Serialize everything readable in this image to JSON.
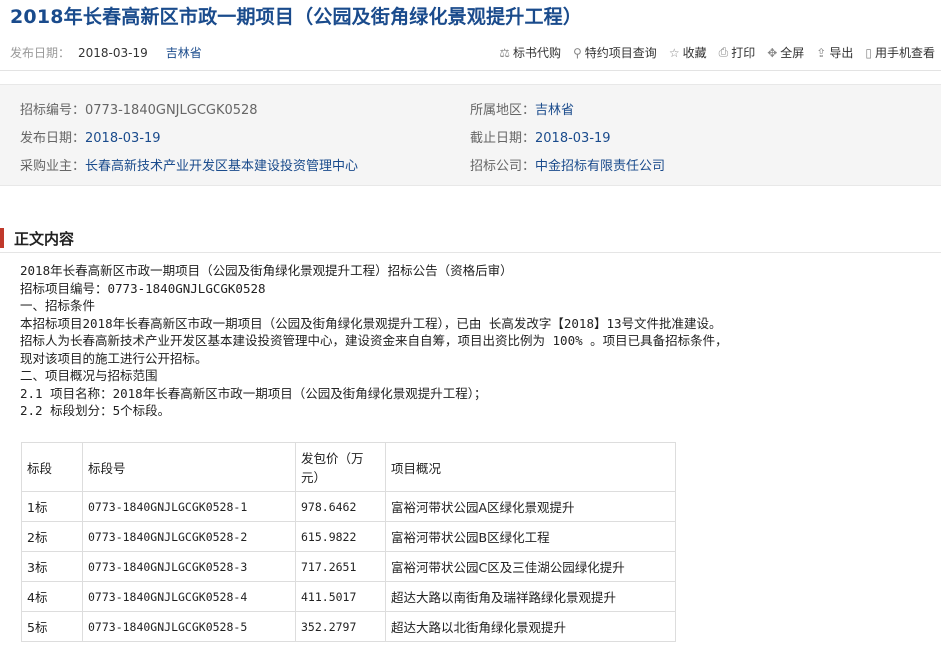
{
  "page_title": "2018年长春高新区市政一期项目（公园及街角绿化景观提升工程）",
  "meta": {
    "publish_label": "发布日期：",
    "publish_date": "2018-03-19",
    "province": "吉林省"
  },
  "toolbar": [
    {
      "label": "标书代购",
      "icon": "document-icon",
      "glyph": "⚖"
    },
    {
      "label": "特约项目查询",
      "icon": "search-icon",
      "glyph": "⚲"
    },
    {
      "label": "收藏",
      "icon": "star-icon",
      "glyph": "☆"
    },
    {
      "label": "打印",
      "icon": "print-icon",
      "glyph": "⎙"
    },
    {
      "label": "全屏",
      "icon": "fullscreen-icon",
      "glyph": "✥"
    },
    {
      "label": "导出",
      "icon": "export-icon",
      "glyph": "⇪"
    },
    {
      "label": "用手机查看",
      "icon": "phone-icon",
      "glyph": "▯"
    }
  ],
  "info": {
    "bid_no_label": "招标编号：",
    "bid_no": "0773-1840GNJLGCGK0528",
    "region_label": "所属地区：",
    "region": "吉林省",
    "publish_label": "发布日期：",
    "publish": "2018-03-19",
    "deadline_label": "截止日期：",
    "deadline": "2018-03-19",
    "owner_label": "采购业主：",
    "owner": "长春高新技术产业开发区基本建设投资管理中心",
    "agency_label": "招标公司：",
    "agency": "中金招标有限责任公司"
  },
  "section_title": "正文内容",
  "body": {
    "line1": "2018年长春高新区市政一期项目（公园及街角绿化景观提升工程）招标公告（资格后审）",
    "line2": "招标项目编号：0773-1840GNJLGCGK0528",
    "line3": "一、招标条件",
    "line4": "本招标项目2018年长春高新区市政一期项目（公园及街角绿化景观提升工程），已由 长高发改字【2018】13号文件批准建设。",
    "line5": "招标人为长春高新技术产业开发区基本建设投资管理中心，建设资金来自自筹，项目出资比例为 100% 。项目已具备招标条件，",
    "line6": "现对该项目的施工进行公开招标。",
    "line7": "二、项目概况与招标范围",
    "line8": "2.1 项目名称：2018年长春高新区市政一期项目（公园及街角绿化景观提升工程）；",
    "line9": "2.2 标段划分：5个标段。"
  },
  "table": {
    "headers": [
      "标段",
      "标段号",
      "发包价（万元）",
      "项目概况"
    ],
    "rows": [
      [
        "1标",
        "0773-1840GNJLGCGK0528-1",
        "978.6462",
        "富裕河带状公园A区绿化景观提升"
      ],
      [
        "2标",
        "0773-1840GNJLGCGK0528-2",
        "615.9822",
        "富裕河带状公园B区绿化工程"
      ],
      [
        "3标",
        "0773-1840GNJLGCGK0528-3",
        "717.2651",
        "富裕河带状公园C区及三佳湖公园绿化提升"
      ],
      [
        "4标",
        "0773-1840GNJLGCGK0528-4",
        "411.5017",
        "超达大路以南街角及瑞祥路绿化景观提升"
      ],
      [
        "5标",
        "0773-1840GNJLGCGK0528-5",
        "352.2797",
        "超达大路以北街角绿化景观提升"
      ]
    ]
  },
  "colors": {
    "title": "#1a4b8c",
    "accent": "#c0392b",
    "link": "#1a4b8c"
  }
}
